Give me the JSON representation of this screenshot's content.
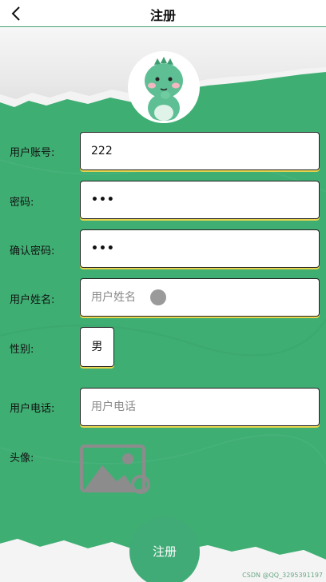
{
  "header": {
    "title": "注册",
    "back_icon": "chevron-left-icon"
  },
  "colors": {
    "accent": "#41ab77",
    "paper": "#3fae73",
    "field_shadow": "#e8d44d"
  },
  "form": {
    "account": {
      "label": "用户账号:",
      "value": "222"
    },
    "password": {
      "label": "密码:",
      "value": "•••"
    },
    "confirm": {
      "label": "确认密码:",
      "value": "•••"
    },
    "name": {
      "label": "用户姓名:",
      "placeholder": "用户姓名"
    },
    "gender": {
      "label": "性别:",
      "value": "男"
    },
    "phone": {
      "label": "用户电话:",
      "placeholder": "用户电话"
    },
    "avatar": {
      "label": "头像:",
      "icon": "image-placeholder-icon"
    }
  },
  "submit": {
    "label": "注册"
  },
  "watermark": "CSDN @QQ_3295391197"
}
